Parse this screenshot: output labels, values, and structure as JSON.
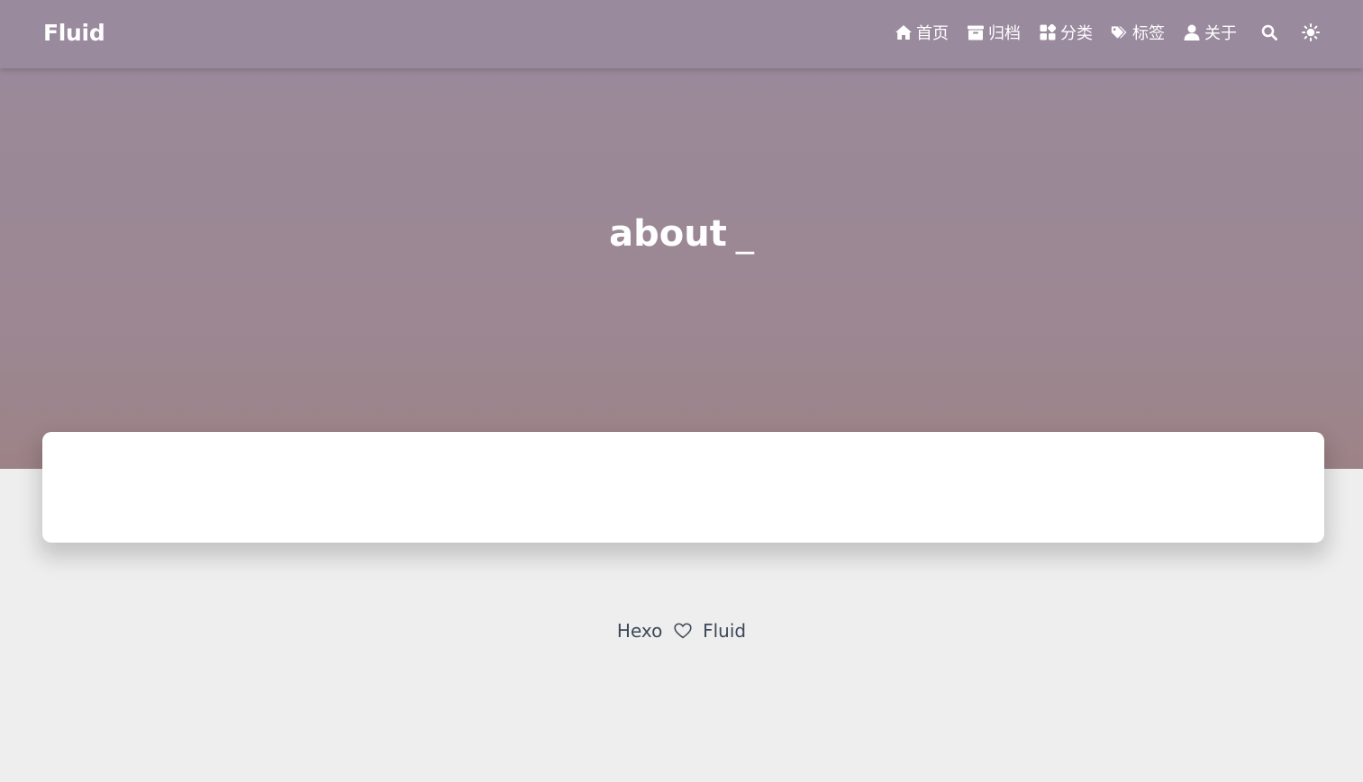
{
  "navbar": {
    "brand": "Fluid",
    "items": [
      {
        "label": "首页",
        "icon": "home-icon"
      },
      {
        "label": "归档",
        "icon": "archive-icon"
      },
      {
        "label": "分类",
        "icon": "category-icon"
      },
      {
        "label": "标签",
        "icon": "tags-icon"
      },
      {
        "label": "关于",
        "icon": "user-icon"
      }
    ],
    "search_icon": "search-icon",
    "theme_icon": "sun-icon"
  },
  "hero": {
    "title": "about",
    "cursor": "_"
  },
  "footer": {
    "left": "Hexo",
    "heart_icon": "heart-icon",
    "right": "Fluid"
  },
  "colors": {
    "navbar": "#9a8a9e",
    "banner_top": "#9a8a9c",
    "banner_bottom": "#9d8387",
    "background": "#eeeeee",
    "card": "#ffffff",
    "footer_text": "#3c4858"
  }
}
